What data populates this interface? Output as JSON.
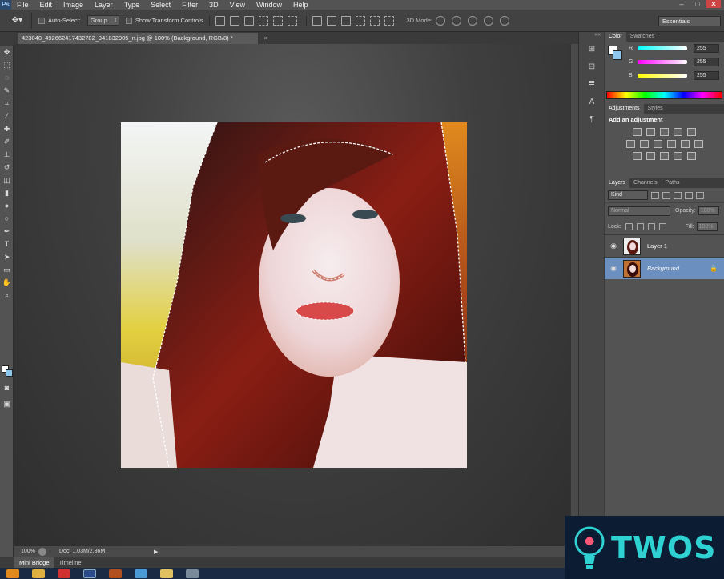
{
  "app": {
    "logo": "Ps"
  },
  "menu": [
    "File",
    "Edit",
    "Image",
    "Layer",
    "Type",
    "Select",
    "Filter",
    "3D",
    "View",
    "Window",
    "Help"
  ],
  "window_controls": [
    "–",
    "□",
    "✕"
  ],
  "options_bar": {
    "auto_select_label": "Auto-Select:",
    "auto_select_value": "Group",
    "show_transform_label": "Show Transform Controls",
    "mode_3d_label": "3D Mode:",
    "workspace": "Essentials"
  },
  "document": {
    "tab_title": "423040_492662417432782_941832905_n.jpg @ 100% (Background, RGB/8) *",
    "tab_close": "×",
    "zoom": "100%",
    "doc_size": "Doc: 1.03M/2.36M",
    "arrow": "▶"
  },
  "bottom_tabs": [
    "Mini Bridge",
    "Timeline"
  ],
  "color_panel": {
    "tabs": [
      "Color",
      "Swatches"
    ],
    "channels": [
      {
        "label": "R",
        "value": "255",
        "color": "#00ffff"
      },
      {
        "label": "G",
        "value": "255",
        "color": "#ff00ff"
      },
      {
        "label": "B",
        "value": "255",
        "color": "#ffff00"
      }
    ]
  },
  "adjustments_panel": {
    "tabs": [
      "Adjustments",
      "Styles"
    ],
    "title": "Add an adjustment"
  },
  "layers_panel": {
    "tabs": [
      "Layers",
      "Channels",
      "Paths"
    ],
    "kind": "Kind",
    "blend_mode": "Normal",
    "opacity_label": "Opacity:",
    "opacity_value": "100%",
    "lock_label": "Lock:",
    "fill_label": "Fill:",
    "fill_value": "100%",
    "layers": [
      {
        "name": "Layer 1",
        "selected": false,
        "locked": false
      },
      {
        "name": "Background",
        "selected": true,
        "locked": true
      }
    ]
  },
  "watermark": {
    "text": "TWOS"
  },
  "colors": {
    "foreground": "#ffffff",
    "background": "#8ec6ee",
    "selection": "#6b8fbf"
  }
}
